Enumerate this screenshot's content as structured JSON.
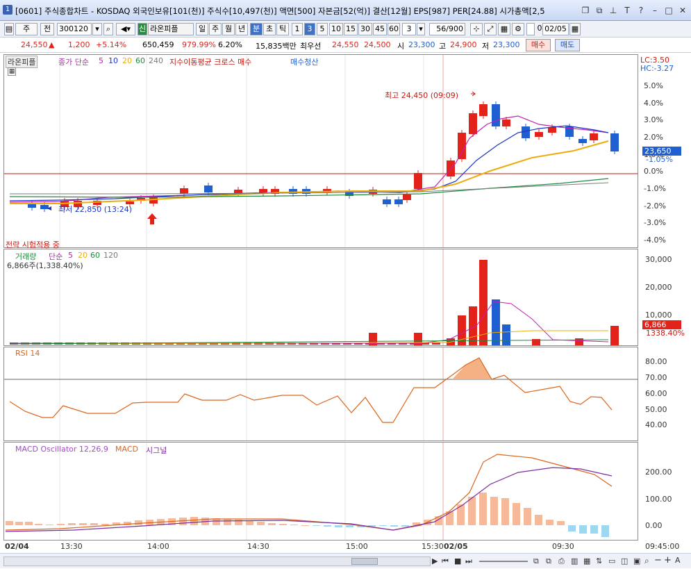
{
  "titlebar": {
    "badge": "1",
    "title": "[0601] 주식종합차트 - KOSDAQ 외국인보유[101(천)] 주식수[10,497(천)] 액면[500] 자본금[52(억)] 결산[12월] EPS[987] PER[24.88] 시가총액[2,5",
    "buttons": [
      "restore-icon",
      "link-icon",
      "pin-icon",
      "text-icon",
      "help-icon",
      "minimize-icon",
      "maximize-icon",
      "close-icon"
    ]
  },
  "toolbar": {
    "period_sel": "주",
    "prev": "전",
    "code": "300120",
    "stock_name": "라온피플",
    "new_badge": "신",
    "intervals": [
      "일",
      "주",
      "월",
      "년",
      "분",
      "초",
      "틱"
    ],
    "minutes": [
      "1",
      "3",
      "5",
      "10",
      "15",
      "30",
      "45",
      "60"
    ],
    "count": "3",
    "range": "56/900",
    "date": "02/05"
  },
  "quote": {
    "price": "24,550",
    "arrow": "▲",
    "change": "1,200",
    "pct": "+5.14%",
    "volume": "650,459",
    "vol_ratio": "979.99%",
    "turnover": "6.20%",
    "amount": "15,835백만",
    "pref_label": "최우선",
    "bid1": "24,550",
    "bid2": "24,500",
    "open_label": "시",
    "open": "23,300",
    "high_label": "고",
    "high": "24,900",
    "low_label": "저",
    "low": "23,300",
    "buy": "매수",
    "sell": "매도"
  },
  "price_panel": {
    "stock_tag": "라온피플",
    "ma_label": "종가 단순",
    "ma_periods": [
      "5",
      "10",
      "20",
      "60",
      "240"
    ],
    "strategy": "지수이동평균 크로스 매수",
    "strategy2": "매수청산",
    "lc": "LC:3.50",
    "hc": "HC:-3.27",
    "high_note": "최고 24,450 (09:09)",
    "low_note": "최저 22,850 (13:24)",
    "test_note": "전략 시험적용 중",
    "current_label": "23,650",
    "current_pct": "-1.05%",
    "yaxis": [
      "5.0%",
      "4.0%",
      "3.0%",
      "2.0%",
      "1.0%",
      "0.0%",
      "-1.0%",
      "-2.0%",
      "-3.0%",
      "-4.0%"
    ]
  },
  "volume_panel": {
    "label": "거래량",
    "ma": "단순",
    "periods": [
      "5",
      "20",
      "60",
      "120"
    ],
    "detail": "6,866주(1,338.40%)",
    "yaxis": [
      "30,000",
      "20,000",
      "10,000"
    ],
    "current": "6,866",
    "current_pct": "1338.40%"
  },
  "rsi_panel": {
    "label": "RSI 14",
    "yaxis": [
      "80.00",
      "70.00",
      "60.00",
      "50.00",
      "40.00"
    ]
  },
  "macd_panel": {
    "label": "MACD Oscillator 12,26,9",
    "macd": "MACD",
    "signal": "시그널",
    "yaxis": [
      "200.00",
      "100.00",
      "0.00"
    ]
  },
  "xaxis": {
    "labels": [
      "02/04",
      "13:30",
      "14:00",
      "14:30",
      "15:00",
      "15:30",
      "02/05",
      "09:30"
    ],
    "right": "09:45:00"
  },
  "colors": {
    "up": "#e32219",
    "down": "#1e5fd2",
    "ma5": "#c21fb4",
    "ma10": "#1b34c8",
    "ma20": "#ecac0c",
    "ma60": "#1d8a3c",
    "ma240": "#7a7a7a"
  }
}
